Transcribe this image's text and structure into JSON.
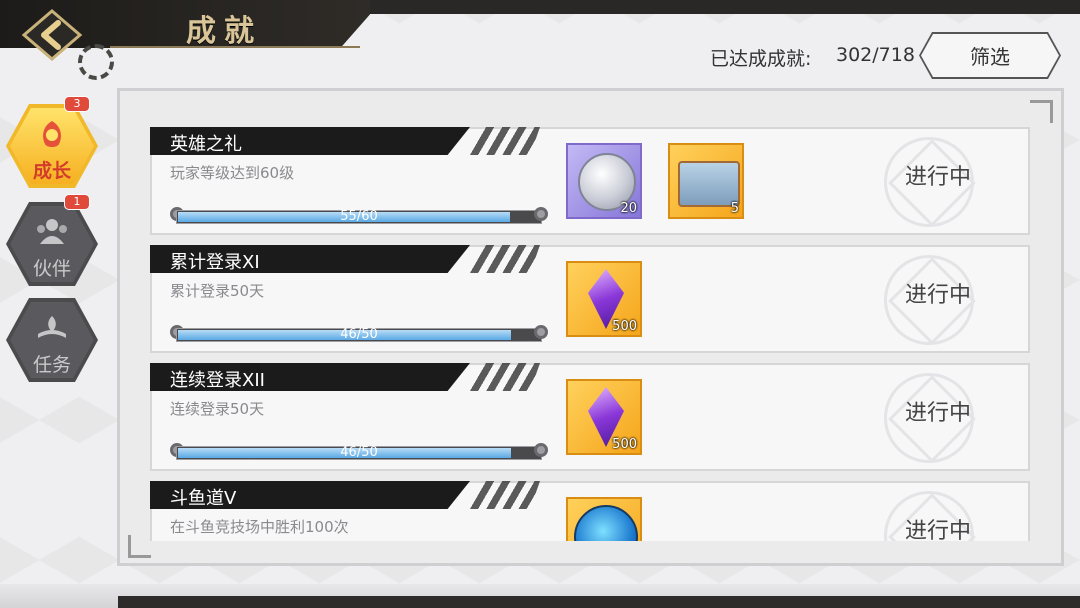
{
  "header": {
    "title": "成就",
    "progress_label": "已达成成就:",
    "progress_value": "302/718",
    "filter_label": "筛选"
  },
  "tabs": [
    {
      "label": "成长",
      "badge": "3",
      "active": true,
      "icon": "growth-icon"
    },
    {
      "label": "伙伴",
      "badge": "1",
      "active": false,
      "icon": "partner-icon"
    },
    {
      "label": "任务",
      "badge": "",
      "active": false,
      "icon": "quest-icon"
    }
  ],
  "achievements": [
    {
      "title": "英雄之礼",
      "desc": "玩家等级达到60级",
      "progress_text": "55/60",
      "progress": 0.9167,
      "rewards": [
        {
          "kind": "coin",
          "qty": "20",
          "frame": "purple",
          "icon": "silver-coin-icon"
        },
        {
          "kind": "chest",
          "qty": "5",
          "frame": "gold",
          "icon": "chest-icon"
        }
      ],
      "status": "进行中"
    },
    {
      "title": "累计登录XI",
      "desc": "累计登录50天",
      "progress_text": "46/50",
      "progress": 0.92,
      "rewards": [
        {
          "kind": "gem",
          "qty": "500",
          "frame": "gold",
          "icon": "purple-crystal-icon"
        }
      ],
      "status": "进行中"
    },
    {
      "title": "连续登录XII",
      "desc": "连续登录50天",
      "progress_text": "46/50",
      "progress": 0.92,
      "rewards": [
        {
          "kind": "gem",
          "qty": "500",
          "frame": "gold",
          "icon": "purple-crystal-icon"
        }
      ],
      "status": "进行中"
    },
    {
      "title": "斗鱼道V",
      "desc": "在斗鱼竞技场中胜利100次",
      "progress_text": "",
      "progress": 0,
      "rewards": [
        {
          "kind": "orb",
          "qty": "",
          "frame": "gold",
          "icon": "blue-orb-icon"
        }
      ],
      "status": "进行中"
    }
  ],
  "colors": {
    "accent_gold": "#f6b021",
    "title_gold": "#d9c597",
    "bar_blue": "#5aa9e5",
    "badge_red": "#e04a3a"
  }
}
